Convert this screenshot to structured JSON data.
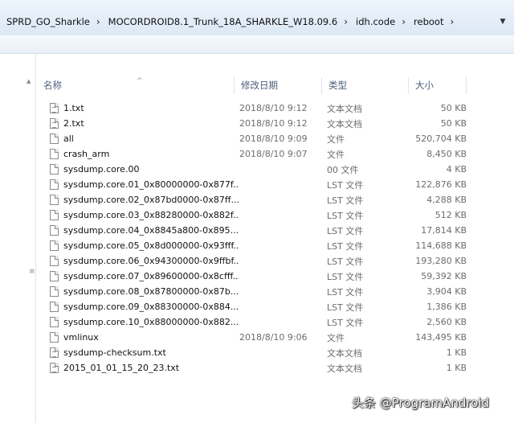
{
  "breadcrumb": [
    "SPRD_GO_Sharkle",
    "MOCORDROID8.1_Trunk_18A_SHARKLE_W18.09.6",
    "idh.code",
    "reboot"
  ],
  "columns": {
    "name": "名称",
    "date": "修改日期",
    "type": "类型",
    "size": "大小"
  },
  "files": [
    {
      "name": "1.txt",
      "date": "2018/8/10 9:12",
      "type": "文本文档",
      "size": "50 KB",
      "icon": "text-file-icon"
    },
    {
      "name": "2.txt",
      "date": "2018/8/10 9:12",
      "type": "文本文档",
      "size": "50 KB",
      "icon": "text-file-icon"
    },
    {
      "name": "all",
      "date": "2018/8/10 9:09",
      "type": "文件",
      "size": "520,704 KB",
      "icon": "file-icon"
    },
    {
      "name": "crash_arm",
      "date": "2018/8/10 9:07",
      "type": "文件",
      "size": "8,450 KB",
      "icon": "file-icon"
    },
    {
      "name": "sysdump.core.00",
      "date": "",
      "type": "00 文件",
      "size": "4 KB",
      "icon": "file-icon"
    },
    {
      "name": "sysdump.core.01_0x80000000-0x877f...",
      "date": "",
      "type": "LST 文件",
      "size": "122,876 KB",
      "icon": "file-icon"
    },
    {
      "name": "sysdump.core.02_0x87bd0000-0x87ff...",
      "date": "",
      "type": "LST 文件",
      "size": "4,288 KB",
      "icon": "file-icon"
    },
    {
      "name": "sysdump.core.03_0x88280000-0x882f...",
      "date": "",
      "type": "LST 文件",
      "size": "512 KB",
      "icon": "file-icon"
    },
    {
      "name": "sysdump.core.04_0x8845a800-0x895...",
      "date": "",
      "type": "LST 文件",
      "size": "17,814 KB",
      "icon": "file-icon"
    },
    {
      "name": "sysdump.core.05_0x8d000000-0x93fff...",
      "date": "",
      "type": "LST 文件",
      "size": "114,688 KB",
      "icon": "file-icon"
    },
    {
      "name": "sysdump.core.06_0x94300000-0x9ffbf...",
      "date": "",
      "type": "LST 文件",
      "size": "193,280 KB",
      "icon": "file-icon"
    },
    {
      "name": "sysdump.core.07_0x89600000-0x8cfff...",
      "date": "",
      "type": "LST 文件",
      "size": "59,392 KB",
      "icon": "file-icon"
    },
    {
      "name": "sysdump.core.08_0x87800000-0x87b...",
      "date": "",
      "type": "LST 文件",
      "size": "3,904 KB",
      "icon": "file-icon"
    },
    {
      "name": "sysdump.core.09_0x88300000-0x884...",
      "date": "",
      "type": "LST 文件",
      "size": "1,386 KB",
      "icon": "file-icon"
    },
    {
      "name": "sysdump.core.10_0x88000000-0x882...",
      "date": "",
      "type": "LST 文件",
      "size": "2,560 KB",
      "icon": "file-icon"
    },
    {
      "name": "vmlinux",
      "date": "2018/8/10 9:06",
      "type": "文件",
      "size": "143,495 KB",
      "icon": "file-icon"
    },
    {
      "name": "sysdump-checksum.txt",
      "date": "",
      "type": "文本文档",
      "size": "1 KB",
      "icon": "text-file-icon"
    },
    {
      "name": "2015_01_01_15_20_23.txt",
      "date": "",
      "type": "文本文档",
      "size": "1 KB",
      "icon": "text-file-icon"
    }
  ],
  "watermark": "头条 @ProgramAndroid"
}
